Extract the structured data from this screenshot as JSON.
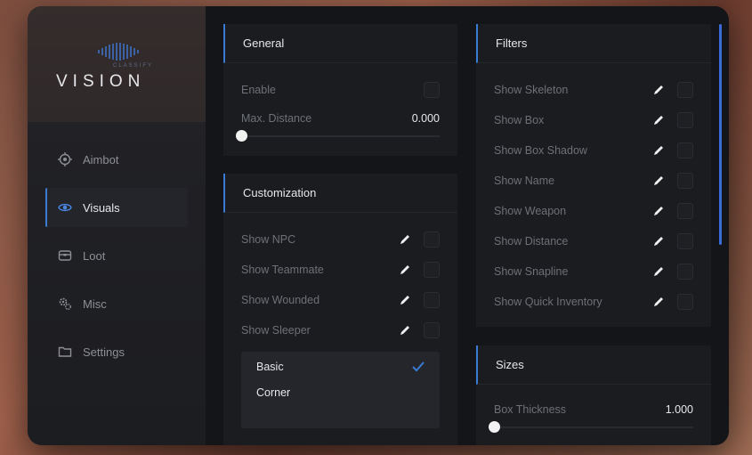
{
  "logo": {
    "main": "VISION",
    "sub": "CLASSIFY"
  },
  "sidebar": {
    "items": [
      {
        "label": "Aimbot",
        "icon": "crosshair-icon"
      },
      {
        "label": "Visuals",
        "icon": "eye-icon",
        "active": true
      },
      {
        "label": "Loot",
        "icon": "box-icon"
      },
      {
        "label": "Misc",
        "icon": "gears-icon"
      },
      {
        "label": "Settings",
        "icon": "folder-icon"
      }
    ]
  },
  "general": {
    "title": "General",
    "enable_label": "Enable",
    "max_distance_label": "Max. Distance",
    "max_distance_value": "0.000",
    "max_distance_fraction": 0.0
  },
  "customization": {
    "title": "Customization",
    "items": [
      "Show NPC",
      "Show Teammate",
      "Show Wounded",
      "Show Sleeper"
    ],
    "dropdown_options": [
      {
        "label": "Basic",
        "selected": true
      },
      {
        "label": "Corner",
        "selected": false
      }
    ]
  },
  "filters": {
    "title": "Filters",
    "items": [
      "Show Skeleton",
      "Show Box",
      "Show Box Shadow",
      "Show Name",
      "Show Weapon",
      "Show Distance",
      "Show Snapline",
      "Show Quick Inventory"
    ]
  },
  "sizes": {
    "title": "Sizes",
    "box_thickness_label": "Box Thickness",
    "box_thickness_value": "1.000"
  },
  "colors": {
    "accent": "#3a7bd5",
    "window": "#131418",
    "panel": "#1b1c20"
  }
}
